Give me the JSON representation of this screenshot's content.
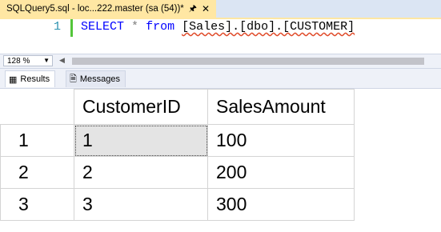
{
  "document_tab": {
    "title": "SQLQuery5.sql - loc...222.master (sa (54))*",
    "pin_icon": "pin-icon",
    "close_icon": "close-icon"
  },
  "editor": {
    "line_number": "1",
    "code": {
      "select": "SELECT",
      "star": "*",
      "from": "from",
      "object": "[Sales].[dbo].[CUSTOMER]"
    }
  },
  "zoom": {
    "value": "128 %"
  },
  "result_tabs": [
    {
      "label": "Results",
      "icon": "grid-icon"
    },
    {
      "label": "Messages",
      "icon": "messages-icon"
    }
  ],
  "results": {
    "columns": [
      "CustomerID",
      "SalesAmount"
    ],
    "rows": [
      {
        "row_no": "1",
        "values": [
          "1",
          "100"
        ]
      },
      {
        "row_no": "2",
        "values": [
          "2",
          "200"
        ]
      },
      {
        "row_no": "3",
        "values": [
          "3",
          "300"
        ]
      }
    ]
  },
  "colors": {
    "active_tab": "#ffe7a3",
    "keyword": "#0000ff",
    "line_number": "#2b91af",
    "change_bar": "#53c53a"
  }
}
